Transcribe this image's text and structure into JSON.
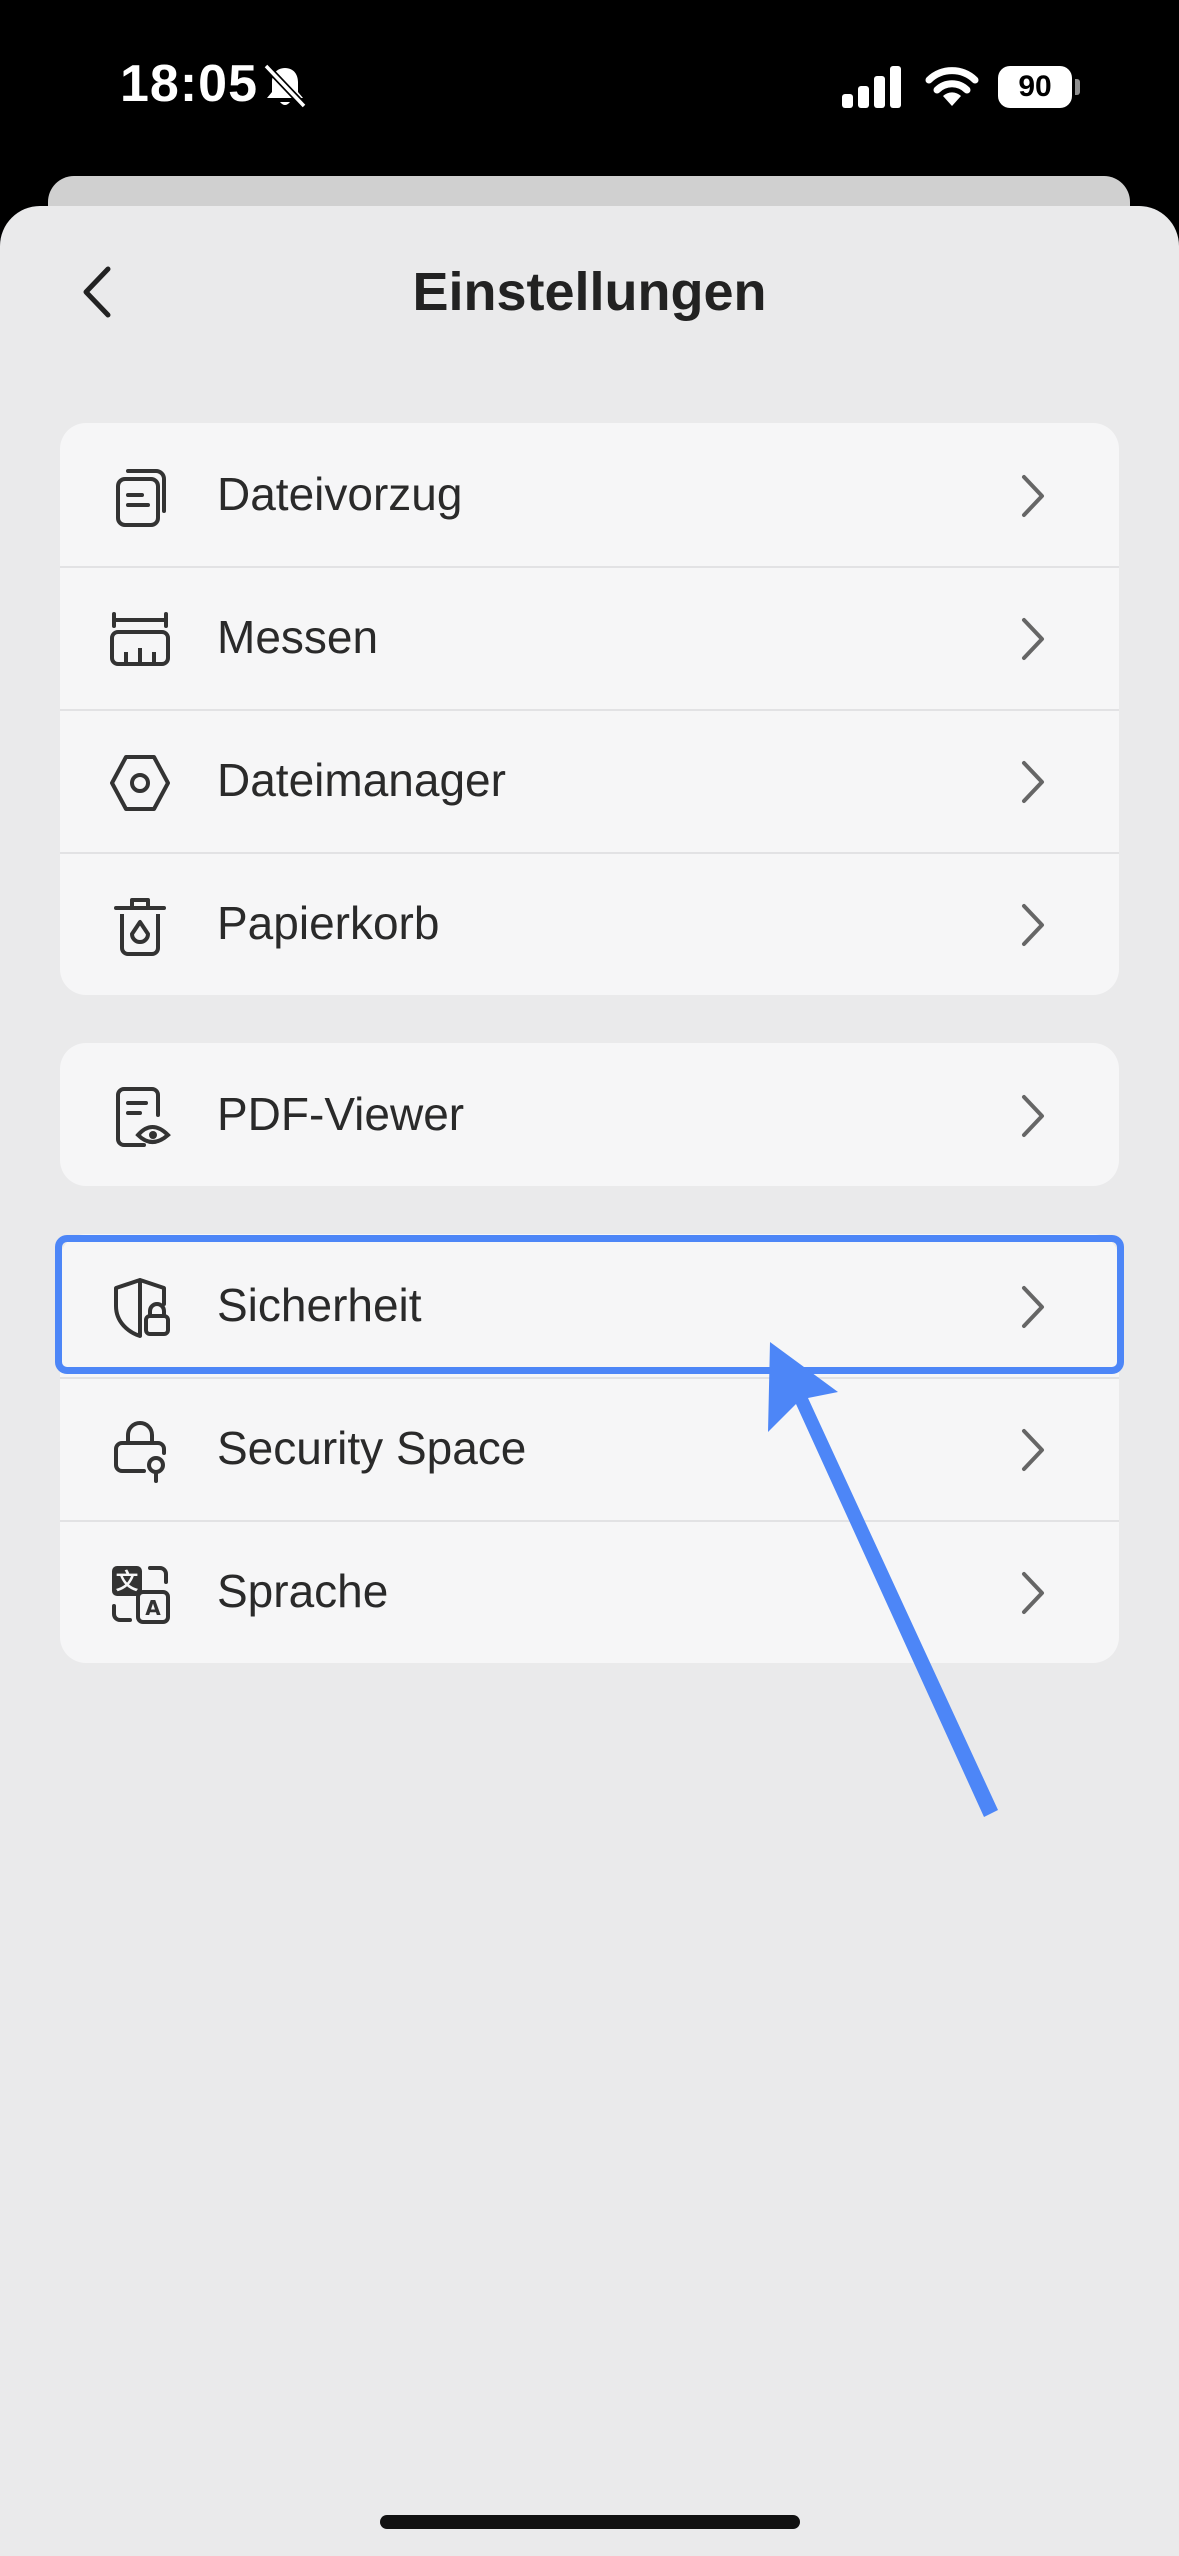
{
  "status_bar": {
    "time": "18:05",
    "battery": "90",
    "icons": [
      "bell-slash-icon",
      "cellular-signal-icon",
      "wifi-icon",
      "battery-icon"
    ]
  },
  "header": {
    "title": "Einstellungen",
    "back_icon": "chevron-left-icon"
  },
  "groups": [
    {
      "items": [
        {
          "label": "Dateivorzug",
          "icon": "file-stack-icon"
        },
        {
          "label": "Messen",
          "icon": "ruler-icon"
        },
        {
          "label": "Dateimanager",
          "icon": "hexagon-icon"
        },
        {
          "label": "Papierkorb",
          "icon": "trash-icon"
        }
      ]
    },
    {
      "items": [
        {
          "label": "PDF-Viewer",
          "icon": "document-eye-icon"
        }
      ]
    },
    {
      "items": [
        {
          "label": "Sicherheit",
          "icon": "shield-lock-icon"
        },
        {
          "label": "Security Space",
          "icon": "lock-key-icon"
        },
        {
          "label": "Sprache",
          "icon": "translate-icon"
        }
      ]
    }
  ],
  "annotation": {
    "highlighted_item": "Sicherheit",
    "color": "#4d86f7"
  },
  "colors": {
    "background": "#eaeaeb",
    "card": "#f6f6f7",
    "text": "#2a2a2a",
    "accent": "#4d86f7"
  }
}
